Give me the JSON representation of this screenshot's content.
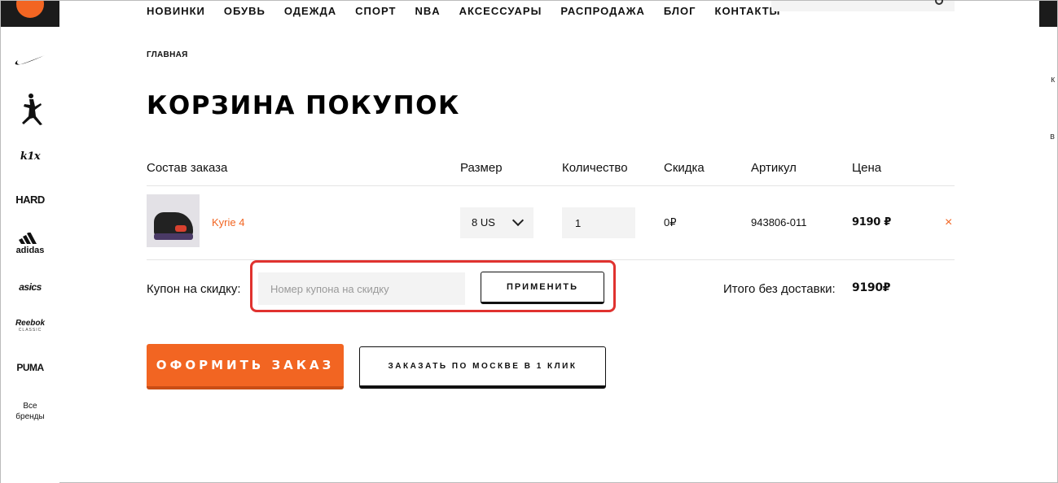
{
  "nav": [
    "НОВИНКИ",
    "ОБУВЬ",
    "ОДЕЖДА",
    "СПОРТ",
    "NBA",
    "АКСЕССУАРЫ",
    "РАСПРОДАЖА",
    "БЛОГ",
    "КОНТАКТЫ"
  ],
  "brands": {
    "k1x": "k1x",
    "hard": "HARD",
    "adidas": "adidas",
    "asics": "asics",
    "reebok": "Reebok",
    "reebok_sub": "CLASSIC",
    "puma": "PUMA",
    "all_line1": "Все",
    "all_line2": "бренды"
  },
  "right_edge": [
    "к",
    "в"
  ],
  "breadcrumb": "ГЛАВНАЯ",
  "page_title": "КОРЗИНА ПОКУПОК",
  "table": {
    "headers": {
      "composition": "Состав заказа",
      "size": "Размер",
      "quantity": "Количество",
      "discount": "Скидка",
      "sku": "Артикул",
      "price": "Цена"
    },
    "row": {
      "name": "Kyrie 4",
      "size": "8 US",
      "quantity": "1",
      "discount": "0₽",
      "sku": "943806-011",
      "price": "9190 ₽",
      "remove": "×"
    }
  },
  "coupon": {
    "label": "Купон на скидку:",
    "placeholder": "Номер купона на скидку",
    "apply": "ПРИМЕНИТЬ"
  },
  "total": {
    "label": "Итого без доставки:",
    "value": "9190₽"
  },
  "actions": {
    "checkout": "ОФОРМИТЬ ЗАКАЗ",
    "one_click": "ЗАКАЗАТЬ ПО МОСКВЕ В 1 КЛИК"
  },
  "colors": {
    "accent": "#f26522",
    "highlight": "#e0322f",
    "dark": "#1b1b1b"
  }
}
